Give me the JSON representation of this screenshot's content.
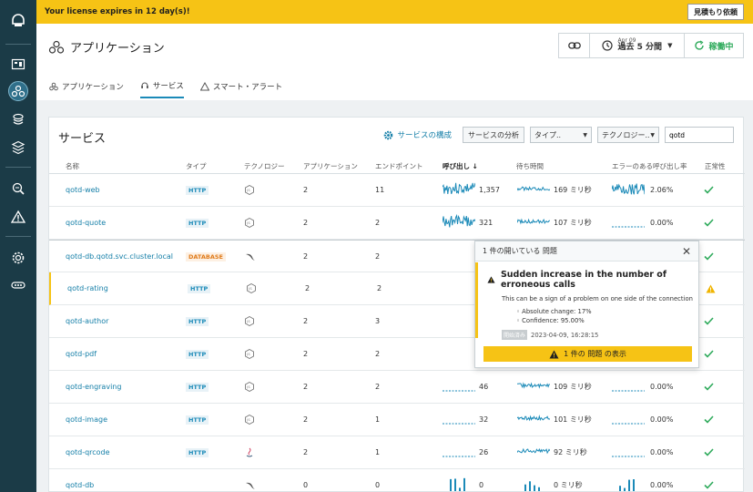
{
  "banner": {
    "text": "Your license expires in 12 day(s)!",
    "quote_label": "見積もり依頼"
  },
  "header": {
    "title": "アプリケーション",
    "date_small": "Apr 09",
    "date_range": "過去 5 分間",
    "status": "稼働中"
  },
  "tabs": [
    {
      "label": "アプリケーション",
      "icon": "app-icon"
    },
    {
      "label": "サービス",
      "icon": "service-icon",
      "active": true
    },
    {
      "label": "スマート・アラート",
      "icon": "alert-triangle-icon"
    }
  ],
  "main": {
    "title": "サービス",
    "config_label": "サービスの構成",
    "analyze_label": "サービスの分析",
    "type_select": "タイプ..",
    "tech_select": "テクノロジー..",
    "search_value": "qotd"
  },
  "columns": {
    "name": "名称",
    "type": "タイプ",
    "tech": "テクノロジー",
    "app": "アプリケーション",
    "endpoint": "エンドポイント",
    "calls": "呼び出し",
    "latency": "待ち時間",
    "error_rate": "エラーのある呼び出し率",
    "health": "正常性"
  },
  "rows": [
    {
      "name": "qotd-web",
      "type": "HTTP",
      "tech": "nodejs-icon",
      "apps": "2",
      "endpoints": "11",
      "calls": "1,357",
      "latency": "169 ミリ秒",
      "error_rate": "2.06%",
      "health": "ok"
    },
    {
      "name": "qotd-quote",
      "type": "HTTP",
      "tech": "nodejs-icon",
      "apps": "2",
      "endpoints": "2",
      "calls": "321",
      "latency": "107 ミリ秒",
      "error_rate": "0.00%",
      "health": "ok"
    },
    {
      "name": "qotd-db.qotd.svc.cluster.local",
      "type": "DATABASE",
      "tech": "mysql-icon",
      "apps": "2",
      "endpoints": "2",
      "calls": "",
      "latency": "",
      "error_rate": "",
      "health": "ok"
    },
    {
      "name": "qotd-rating",
      "type": "HTTP",
      "tech": "nodejs-icon",
      "apps": "2",
      "endpoints": "2",
      "calls": "",
      "latency": "",
      "error_rate": "",
      "health": "warn"
    },
    {
      "name": "qotd-author",
      "type": "HTTP",
      "tech": "nodejs-icon",
      "apps": "2",
      "endpoints": "3",
      "calls": "",
      "latency": "",
      "error_rate": "",
      "health": "ok"
    },
    {
      "name": "qotd-pdf",
      "type": "HTTP",
      "tech": "nodejs-icon",
      "apps": "2",
      "endpoints": "2",
      "calls": "",
      "latency": "",
      "error_rate": "",
      "health": "ok"
    },
    {
      "name": "qotd-engraving",
      "type": "HTTP",
      "tech": "nodejs-icon",
      "apps": "2",
      "endpoints": "2",
      "calls": "46",
      "latency": "109 ミリ秒",
      "error_rate": "0.00%",
      "health": "ok"
    },
    {
      "name": "qotd-image",
      "type": "HTTP",
      "tech": "nodejs-icon",
      "apps": "2",
      "endpoints": "1",
      "calls": "32",
      "latency": "101 ミリ秒",
      "error_rate": "0.00%",
      "health": "ok"
    },
    {
      "name": "qotd-qrcode",
      "type": "HTTP",
      "tech": "java-icon",
      "apps": "2",
      "endpoints": "1",
      "calls": "26",
      "latency": "92 ミリ秒",
      "error_rate": "0.00%",
      "health": "ok"
    },
    {
      "name": "qotd-db",
      "type": "",
      "tech": "mysql-icon",
      "apps": "0",
      "endpoints": "0",
      "calls": "0",
      "latency": "0 ミリ秒",
      "error_rate": "0.00%",
      "health": "ok"
    }
  ],
  "popup": {
    "header": "1 件の開いている 問題",
    "title": "Sudden increase in the number of erroneous calls",
    "desc": "This can be a sign of a problem on one side of the connection",
    "bullet1": "Absolute change: 17%",
    "bullet2": "Confidence: 95.00%",
    "tag": "開始済み",
    "time": "2023-04-09, 16:28:15",
    "button": "1 件の 問題 の表示"
  },
  "colors": {
    "accent": "#1b8ab8",
    "warning": "#f6c315",
    "ok": "#2eaa5b",
    "sidebar": "#1b3b47"
  }
}
